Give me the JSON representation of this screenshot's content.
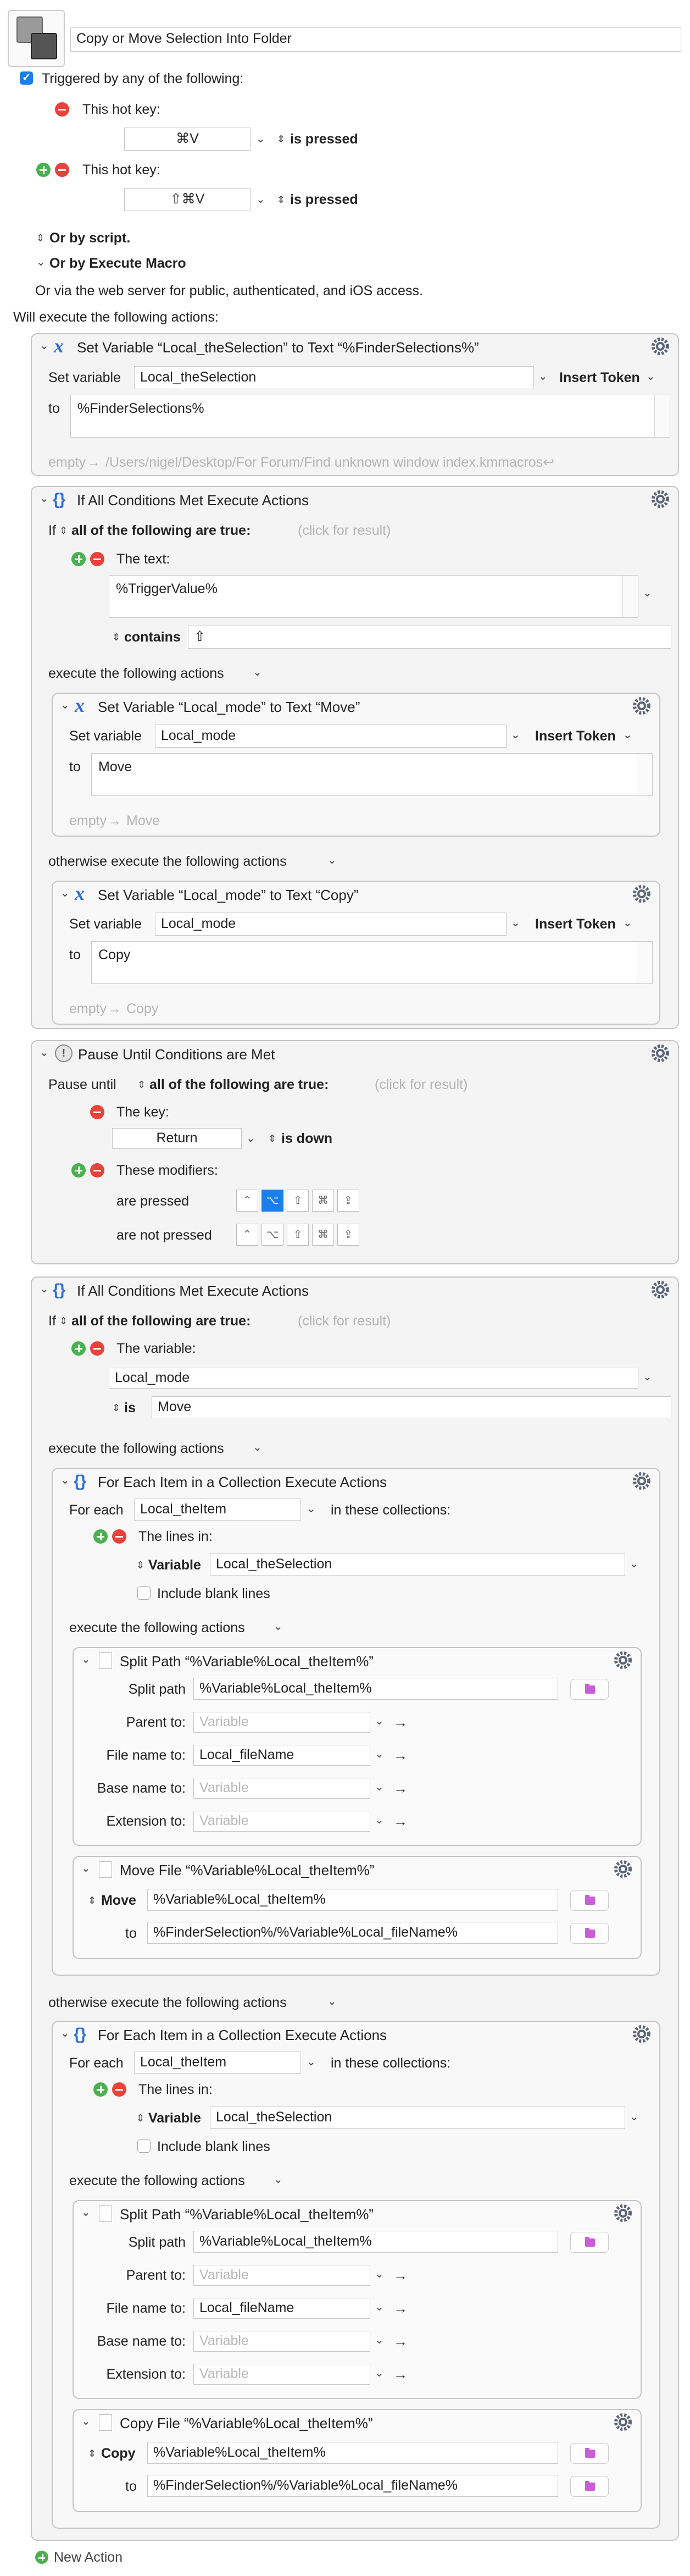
{
  "header": {
    "title": "Copy or Move Selection Into Folder"
  },
  "trigger": {
    "label": "Triggered by any of the following:",
    "hotkey_label": "This hot key:",
    "hotkey1": "⌘V",
    "hotkey2": "⇧⌘V",
    "is_pressed": "is pressed",
    "or_script": "Or by script.",
    "or_execute": "Or by Execute Macro",
    "web_server": "Or via the web server for public, authenticated, and iOS access."
  },
  "will_execute": "Will execute the following actions:",
  "a1": {
    "title": "Set Variable “Local_theSelection” to Text “%FinderSelections%”",
    "set_label": "Set variable",
    "var": "Local_theSelection",
    "insert": "Insert Token",
    "to": "to",
    "value": "%FinderSelections%",
    "preview_prefix": "empty",
    "preview": "/Users/nigel/Desktop/For Forum/Find unknown window index.kmmacros↩"
  },
  "a2": {
    "title": "If All Conditions Met Execute Actions",
    "if": "If",
    "cond": "all of the following are true:",
    "click": "(click for result)",
    "text_label": "The text:",
    "text_value": "%TriggerValue%",
    "contains": "contains",
    "contains_value": "⇧",
    "exec": "execute the following actions",
    "otherwise": "otherwise execute the following actions",
    "move": {
      "title": "Set Variable “Local_mode” to Text “Move”",
      "set_label": "Set variable",
      "var": "Local_mode",
      "insert": "Insert Token",
      "to": "to",
      "value": "Move",
      "preview_prefix": "empty",
      "preview": "Move"
    },
    "copy": {
      "title": "Set Variable “Local_mode” to Text “Copy”",
      "set_label": "Set variable",
      "var": "Local_mode",
      "insert": "Insert Token",
      "to": "to",
      "value": "Copy",
      "preview_prefix": "empty",
      "preview": "Copy"
    }
  },
  "a3": {
    "title": "Pause Until Conditions are Met",
    "pause": "Pause until",
    "cond": "all of the following are true:",
    "click": "(click for result)",
    "key_label": "The key:",
    "key": "Return",
    "is_down": "is down",
    "mods_label": "These modifiers:",
    "pressed": "are pressed",
    "not_pressed": "are not pressed"
  },
  "a4": {
    "title": "If All Conditions Met Execute Actions",
    "if": "If",
    "cond": "all of the following are true:",
    "click": "(click for result)",
    "var_label": "The variable:",
    "var": "Local_mode",
    "is": "is",
    "is_value": "Move",
    "exec": "execute the following actions",
    "otherwise": "otherwise execute the following actions",
    "fe1": {
      "title": "For Each Item in a Collection Execute Actions",
      "for_each": "For each",
      "item": "Local_theItem",
      "in_coll": "in these collections:",
      "lines": "The lines in:",
      "variable": "Variable",
      "var": "Local_theSelection",
      "blank": "Include blank lines",
      "exec": "execute the following actions"
    },
    "sp1": {
      "title": "Split Path “%Variable%Local_theItem%”",
      "path_label": "Split path",
      "path": "%Variable%Local_theItem%",
      "parent": "Parent to:",
      "file": "File name to:",
      "base": "Base name to:",
      "ext": "Extension to:",
      "placeholder": "Variable",
      "file_var": "Local_fileName"
    },
    "mv": {
      "title": "Move File “%Variable%Local_theItem%”",
      "op": "Move",
      "src": "%Variable%Local_theItem%",
      "to": "to",
      "dst": "%FinderSelection%/%Variable%Local_fileName%"
    },
    "fe2": {
      "title": "For Each Item in a Collection Execute Actions",
      "for_each": "For each",
      "item": "Local_theItem",
      "in_coll": "in these collections:",
      "lines": "The lines in:",
      "variable": "Variable",
      "var": "Local_theSelection",
      "blank": "Include blank lines",
      "exec": "execute the following actions"
    },
    "sp2": {
      "title": "Split Path “%Variable%Local_theItem%”",
      "path_label": "Split path",
      "path": "%Variable%Local_theItem%",
      "parent": "Parent to:",
      "file": "File name to:",
      "base": "Base name to:",
      "ext": "Extension to:",
      "placeholder": "Variable",
      "file_var": "Local_fileName"
    },
    "cp": {
      "title": "Copy File “%Variable%Local_theItem%”",
      "op": "Copy",
      "src": "%Variable%Local_theItem%",
      "to": "to",
      "dst": "%FinderSelection%/%Variable%Local_fileName%"
    }
  },
  "new_action": "New Action",
  "mod_keys": [
    "⌃",
    "⌥",
    "⇧",
    "⌘",
    "⇪"
  ],
  "colors": {
    "accent": "#1a7fe8",
    "remove": "#e8423a",
    "add": "#4caf50",
    "folder": "#c95fd6"
  }
}
